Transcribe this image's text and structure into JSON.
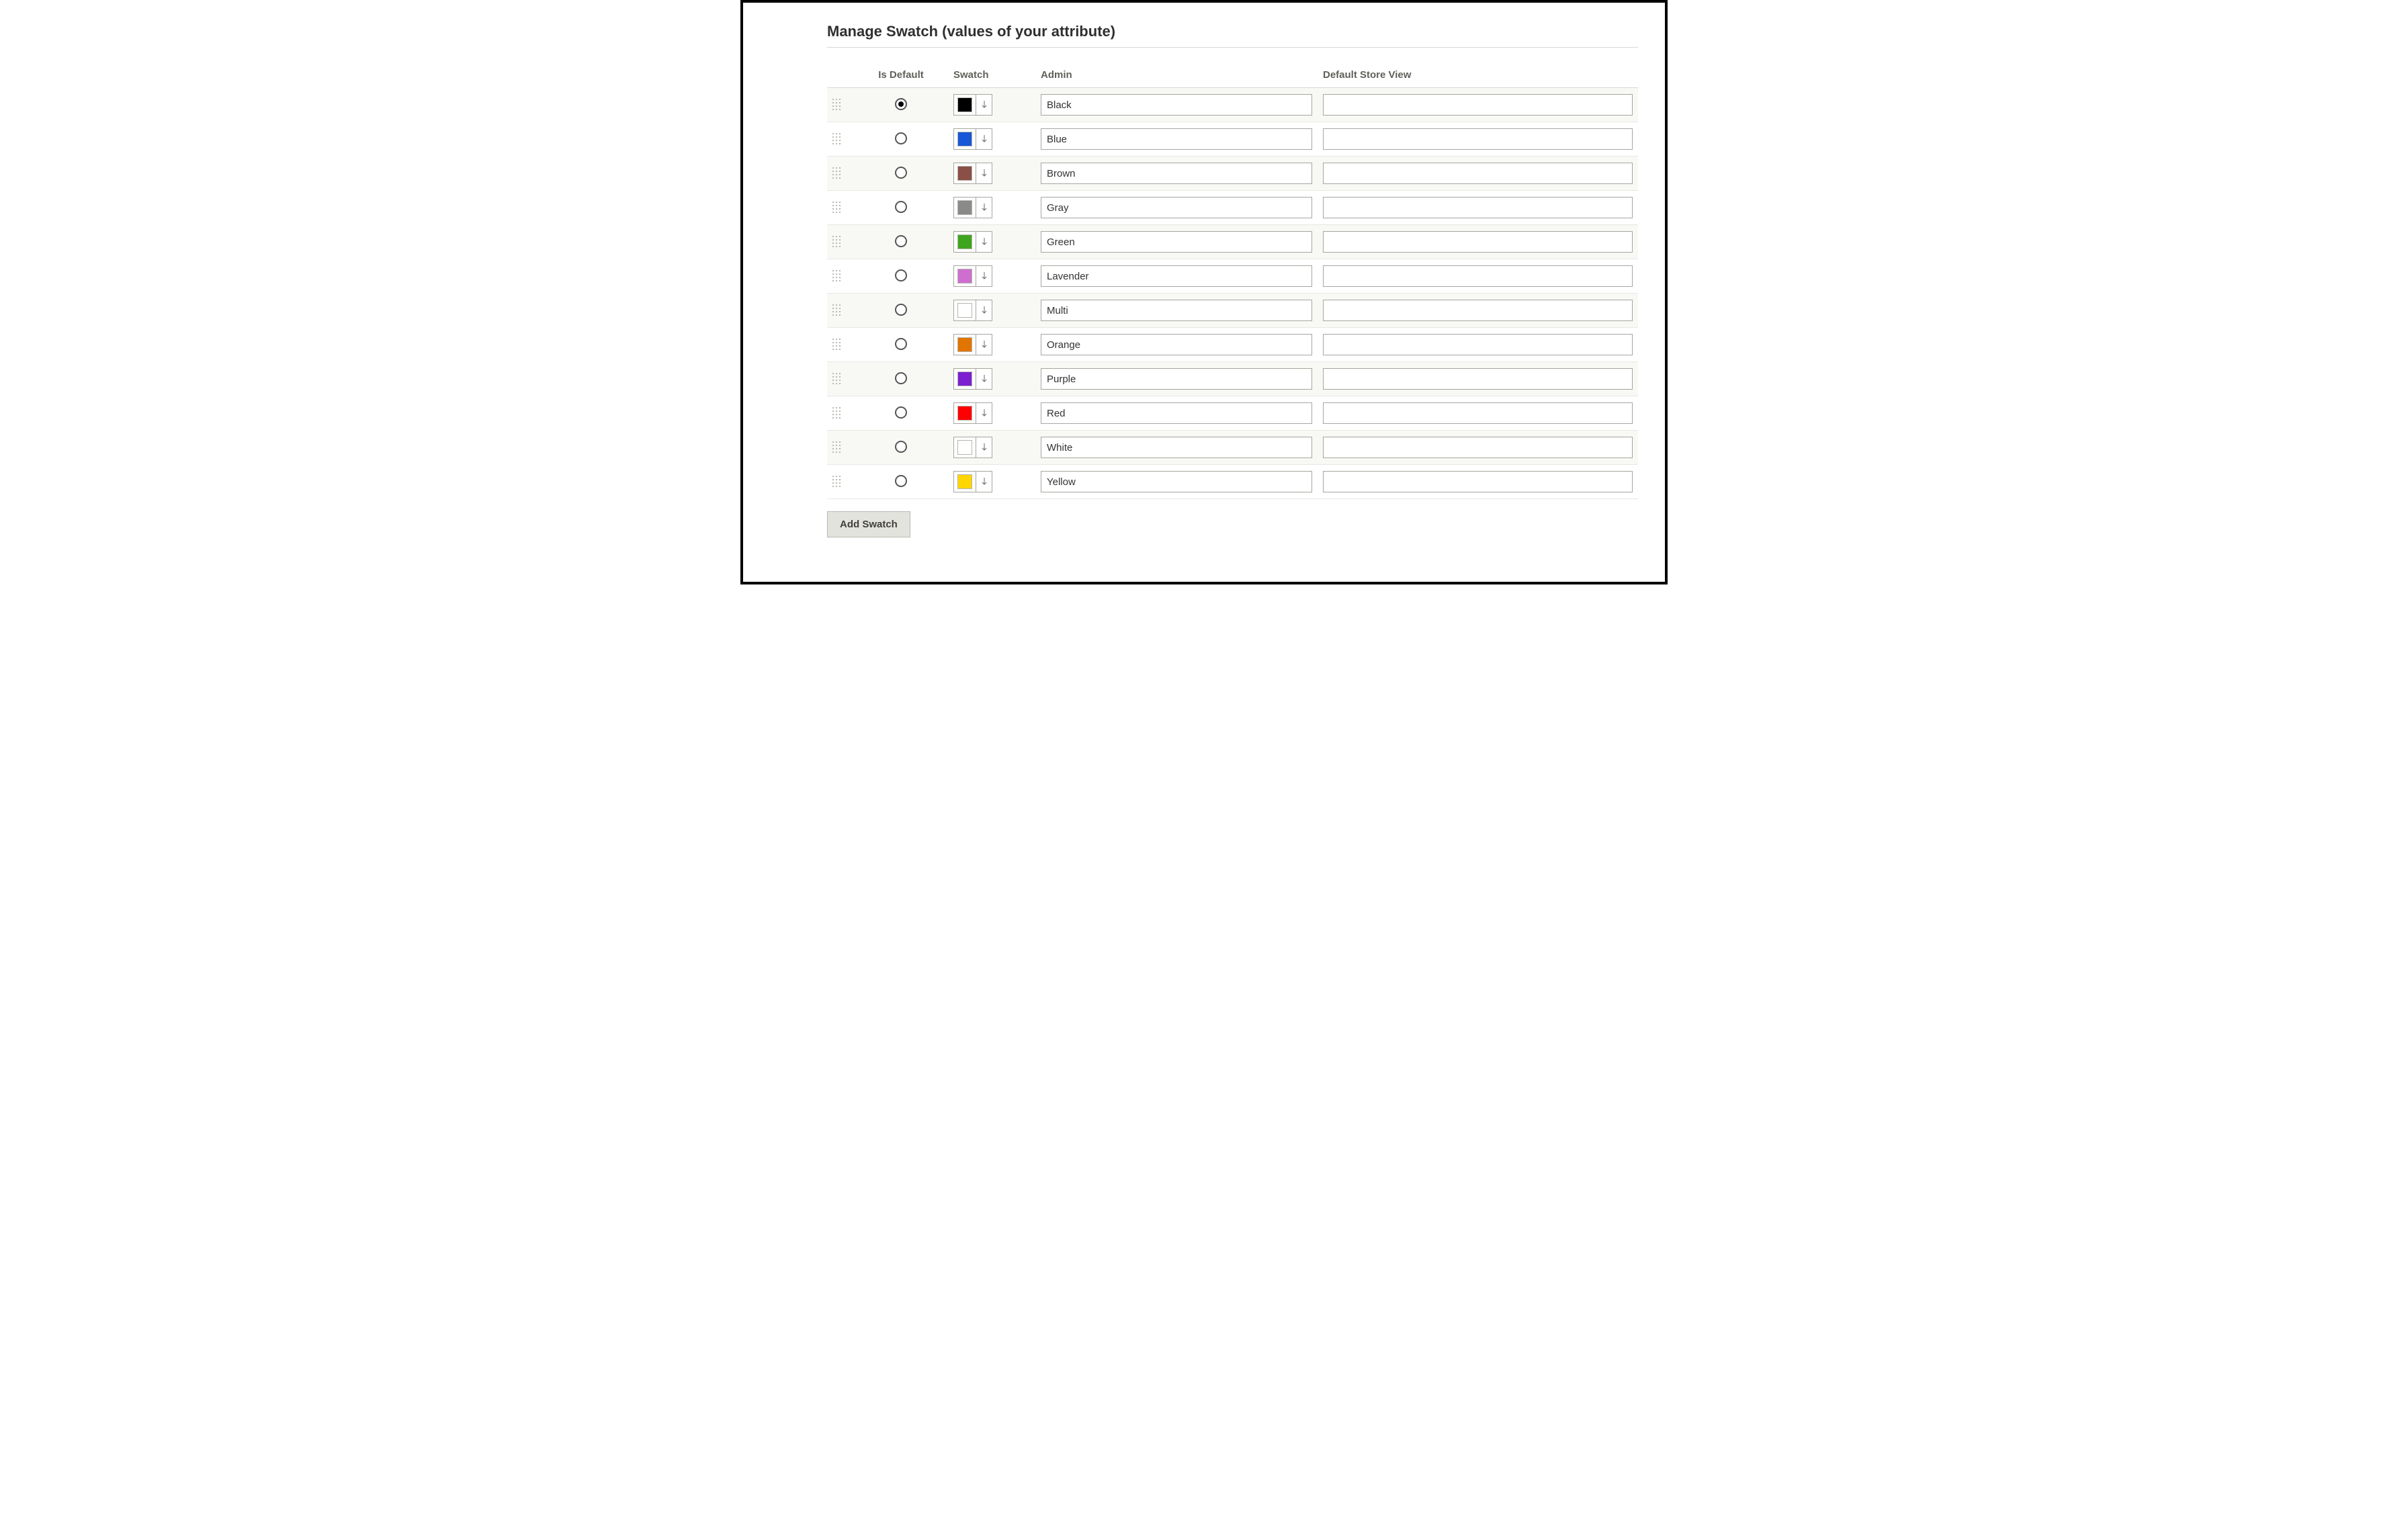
{
  "title": "Manage Swatch (values of your attribute)",
  "columns": {
    "drag": "",
    "is_default": "Is Default",
    "swatch": "Swatch",
    "admin": "Admin",
    "default_store_view": "Default Store View"
  },
  "rows": [
    {
      "default": true,
      "color": "#000000",
      "admin": "Black",
      "store": ""
    },
    {
      "default": false,
      "color": "#1857d6",
      "admin": "Blue",
      "store": ""
    },
    {
      "default": false,
      "color": "#8b4f47",
      "admin": "Brown",
      "store": ""
    },
    {
      "default": false,
      "color": "#8a8a8a",
      "admin": "Gray",
      "store": ""
    },
    {
      "default": false,
      "color": "#3ea51e",
      "admin": "Green",
      "store": ""
    },
    {
      "default": false,
      "color": "#ce6fcf",
      "admin": "Lavender",
      "store": ""
    },
    {
      "default": false,
      "color": "#ffffff",
      "admin": "Multi",
      "store": ""
    },
    {
      "default": false,
      "color": "#e27400",
      "admin": "Orange",
      "store": ""
    },
    {
      "default": false,
      "color": "#7b1fd1",
      "admin": "Purple",
      "store": ""
    },
    {
      "default": false,
      "color": "#ff0000",
      "admin": "Red",
      "store": ""
    },
    {
      "default": false,
      "color": "#ffffff",
      "admin": "White",
      "store": ""
    },
    {
      "default": false,
      "color": "#ffd600",
      "admin": "Yellow",
      "store": ""
    }
  ],
  "add_button": "Add Swatch"
}
